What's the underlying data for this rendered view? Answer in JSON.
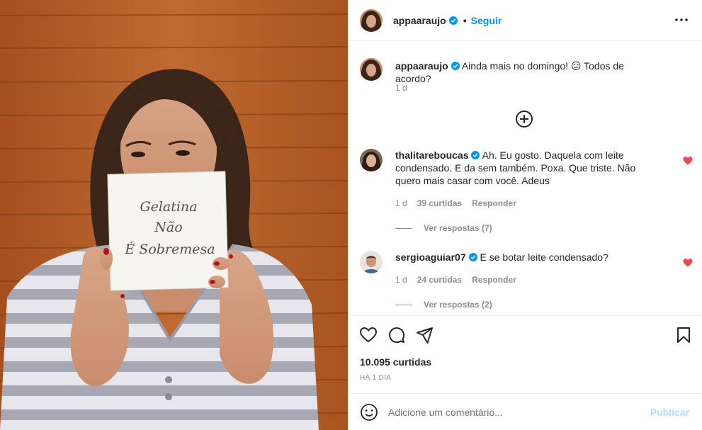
{
  "photo": {
    "card_lines": [
      "Gelatina",
      "Não",
      "É Sobremesa"
    ]
  },
  "header": {
    "username": "appaaraujo",
    "separator": "•",
    "follow_label": "Seguir",
    "avatar_icon": "profile-avatar",
    "more_icon": "more-options-icon"
  },
  "caption": {
    "username": "appaaraujo",
    "text": "Ainda mais no domingo! 😑 Todos de acordo?",
    "time": "1 d"
  },
  "load_more_icon": "plus-circle-icon",
  "comments": [
    {
      "username": "thalitareboucas",
      "text": "Ah. Eu gosto. Daquela com leite condensado. E da sem também. Poxa. Que triste. Não quero mais casar com você. Adeus",
      "time": "1 d",
      "likes": "39 curtidas",
      "reply_label": "Responder",
      "view_replies": "Ver respostas (7)"
    },
    {
      "username": "sergioaguiar07",
      "text": "E se botar leite condensado?",
      "time": "1 d",
      "likes": "24 curtidas",
      "reply_label": "Responder",
      "view_replies": "Ver respostas (2)"
    }
  ],
  "actions": {
    "icons": [
      "heart-icon",
      "comment-icon",
      "share-icon",
      "bookmark-icon"
    ],
    "likes": "10.095 curtidas",
    "date": "HÁ 1 DIA"
  },
  "add_comment": {
    "placeholder": "Adicione um comentário...",
    "post_label": "Publicar"
  },
  "colors": {
    "accent": "#0095f6",
    "post_disabled": "#b3dbff",
    "like_red": "#ed4956",
    "muted": "#8e8e8e",
    "wood": "#b25a26"
  }
}
